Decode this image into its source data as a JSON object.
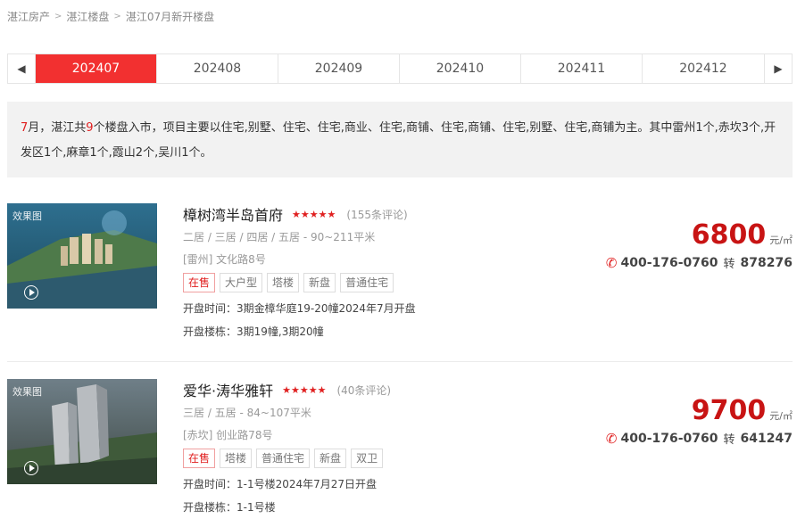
{
  "breadcrumb": [
    "湛江房产",
    "湛江楼盘",
    "湛江07月新开楼盘"
  ],
  "tabs": [
    "202407",
    "202408",
    "202409",
    "202410",
    "202411",
    "202412"
  ],
  "active_tab": "202407",
  "summary": {
    "month": "7",
    "p1": "月，湛江共",
    "count": "9",
    "p2": "个楼盘入市，项目主要以住宅,别墅、住宅、住宅,商业、住宅,商铺、住宅,商铺、住宅,别墅、住宅,商铺为主。其中雷州1个,赤坎3个,开发区1个,麻章1个,霞山2个,吴川1个。"
  },
  "listings": [
    {
      "thumb_tag": "效果图",
      "title": "樟树湾半岛首府",
      "rating": 5,
      "reviews": "(155条评论)",
      "specs": "二居 / 三居 / 四居 / 五居  - 90~211平米",
      "address": "[雷州] 文化路8号",
      "status": "在售",
      "tags": [
        "大户型",
        "塔楼",
        "新盘",
        "普通住宅"
      ],
      "open_time": "开盘时间：3期金樟华庭19-20幢2024年7月开盘",
      "open_buildings": "开盘楼栋：3期19幢,3期20幢",
      "price": "6800",
      "unit": "元/㎡",
      "phone": "400-176-0760",
      "ext_label": "转",
      "ext": "878276"
    },
    {
      "thumb_tag": "效果图",
      "title": "爱华·涛华雅轩",
      "rating": 5,
      "reviews": "(40条评论)",
      "specs": "三居 / 五居  - 84~107平米",
      "address": "[赤坎] 创业路78号",
      "status": "在售",
      "tags": [
        "塔楼",
        "普通住宅",
        "新盘",
        "双卫"
      ],
      "open_time": "开盘时间：1-1号楼2024年7月27日开盘",
      "open_buildings": "开盘楼栋：1-1号楼",
      "price": "9700",
      "unit": "元/㎡",
      "phone": "400-176-0760",
      "ext_label": "转",
      "ext": "641247"
    }
  ],
  "colors": {
    "accent": "#f23030",
    "price": "#c81414",
    "text_muted": "#999999"
  },
  "icons": [
    "arrow-left-icon",
    "arrow-right-icon",
    "star-icon",
    "phone-icon",
    "play-icon"
  ]
}
